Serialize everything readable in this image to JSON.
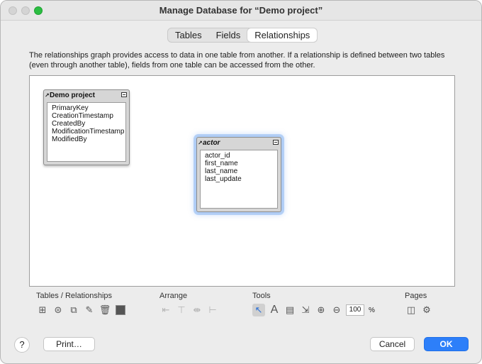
{
  "window": {
    "title": "Manage Database for “Demo project”"
  },
  "tabs": [
    {
      "label": "Tables"
    },
    {
      "label": "Fields"
    },
    {
      "label": "Relationships",
      "active": true
    }
  ],
  "description": "The relationships graph provides access to data in one table from another. If a relationship is defined between two tables (even through another table), fields from one table can be accessed from the other.",
  "graph": {
    "tables": [
      {
        "name": "Demo project",
        "italic": false,
        "selected": false,
        "fields": [
          "PrimaryKey",
          "CreationTimestamp",
          "CreatedBy",
          "ModificationTimestamp",
          "ModifiedBy"
        ]
      },
      {
        "name": "actor",
        "italic": true,
        "selected": true,
        "fields": [
          "actor_id",
          "first_name",
          "last_name",
          "last_update"
        ]
      }
    ]
  },
  "toolbar": {
    "tables_relationships_label": "Tables / Relationships",
    "arrange_label": "Arrange",
    "tools_label": "Tools",
    "pages_label": "Pages",
    "zoom_value": "100",
    "zoom_unit": "%"
  },
  "buttons": {
    "help": "?",
    "print": "Print…",
    "cancel": "Cancel",
    "ok": "OK"
  },
  "colors": {
    "accent": "#2d7ff9",
    "selection_glow": "#78aaf0"
  }
}
